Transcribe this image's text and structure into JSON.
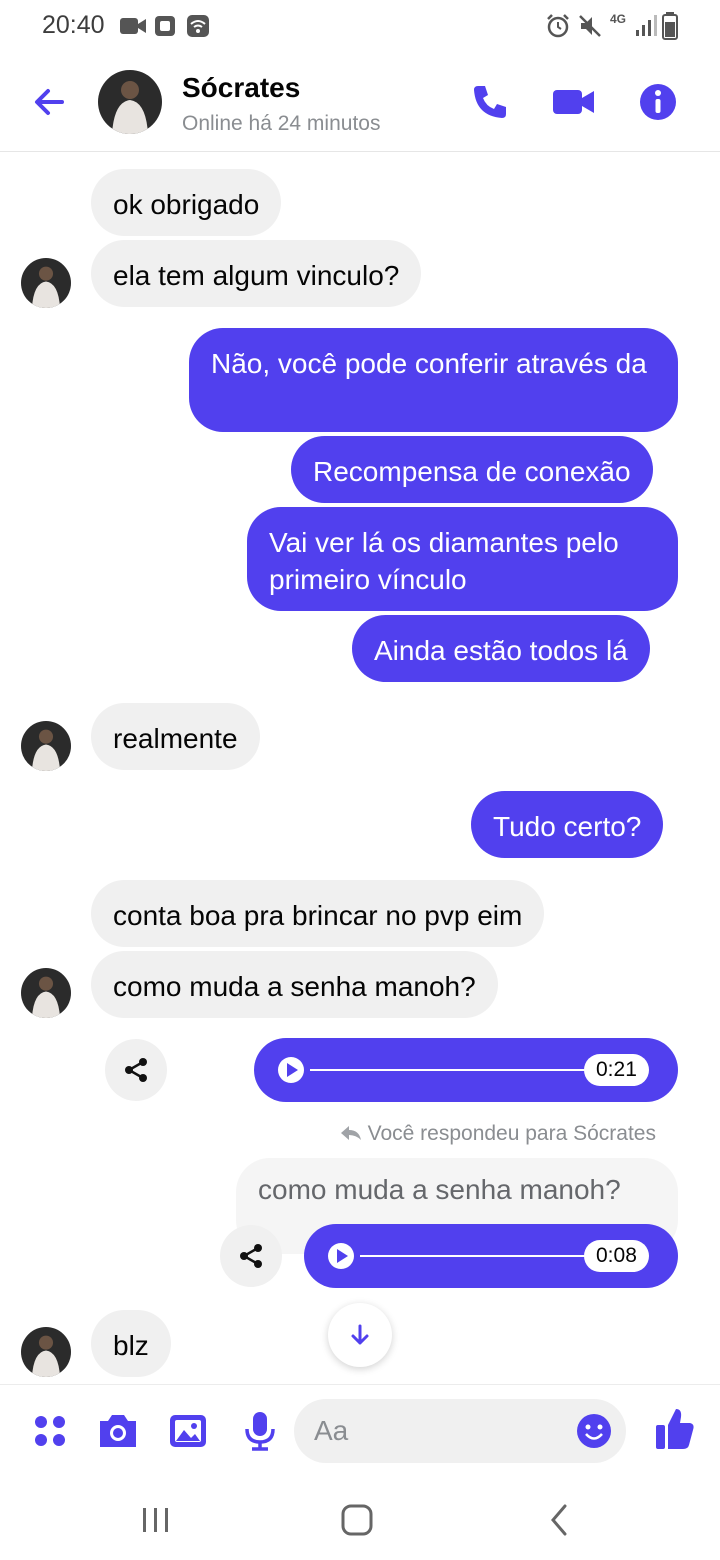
{
  "status_bar": {
    "time": "20:40",
    "network": "4G"
  },
  "header": {
    "contact_name": "Sócrates",
    "contact_status": "Online há 24 minutos"
  },
  "messages": [
    {
      "dir": "in",
      "text": "ok obrigado"
    },
    {
      "dir": "in",
      "text": "ela tem algum vinculo?"
    },
    {
      "dir": "out",
      "text": "Não, você pode conferir através da"
    },
    {
      "dir": "out",
      "text": "Recompensa de conexão"
    },
    {
      "dir": "out",
      "text": "Vai ver lá os diamantes pelo primeiro vínculo"
    },
    {
      "dir": "out",
      "text": "Ainda estão todos lá"
    },
    {
      "dir": "in",
      "text": "realmente"
    },
    {
      "dir": "out",
      "text": "Tudo certo?"
    },
    {
      "dir": "in",
      "text": "conta boa pra brincar no pvp eim"
    },
    {
      "dir": "in",
      "text": "como muda a senha manoh?"
    },
    {
      "dir": "in",
      "text": "blz"
    }
  ],
  "audio_messages": [
    {
      "duration": "0:21"
    },
    {
      "duration": "0:08"
    }
  ],
  "reply": {
    "note": "Você respondeu para Sócrates",
    "quoted_text": "como muda a senha manoh?"
  },
  "composer": {
    "placeholder": "Aa"
  },
  "colors": {
    "accent": "#5140ee",
    "incoming_bubble": "#f0f0f0"
  }
}
